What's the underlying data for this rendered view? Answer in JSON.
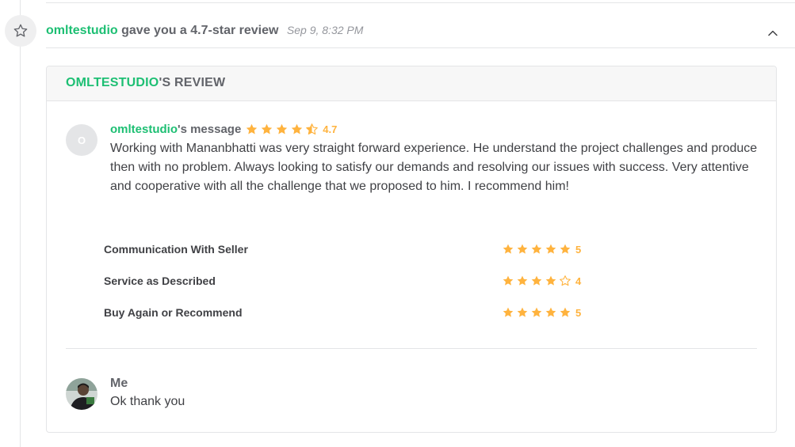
{
  "event": {
    "reviewer": "omltestudio",
    "action_text": "gave you a 4.7-star review",
    "timestamp": "Sep 9, 8:32 PM",
    "icon": "star-outline-icon",
    "collapse_icon": "chevron-up-icon"
  },
  "card": {
    "title_name": "OMLTESTUDIO",
    "title_suffix": "'S REVIEW"
  },
  "message": {
    "avatar_letter": "O",
    "author": "omltestudio",
    "author_suffix": "'s message",
    "rating": 4.7,
    "rating_label": "4.7",
    "body": "Working with Mananbhatti was very straight forward experience. He understand the project challenges and produce then with no problem. Always looking to satisfy our demands and resolving our issues with success. Very attentive and cooperative with all the challenge that we proposed to him. I recommend him!"
  },
  "breakdown": [
    {
      "label": "Communication With Seller",
      "rating": 5,
      "rating_label": "5"
    },
    {
      "label": "Service as Described",
      "rating": 4,
      "rating_label": "4"
    },
    {
      "label": "Buy Again or Recommend",
      "rating": 5,
      "rating_label": "5"
    }
  ],
  "reply": {
    "author": "Me",
    "text": "Ok thank you"
  },
  "colors": {
    "accent_green": "#1dbf73",
    "star": "#ffb33e",
    "text_dark": "#404145",
    "text_muted": "#62646a",
    "border": "#e4e5e7"
  }
}
